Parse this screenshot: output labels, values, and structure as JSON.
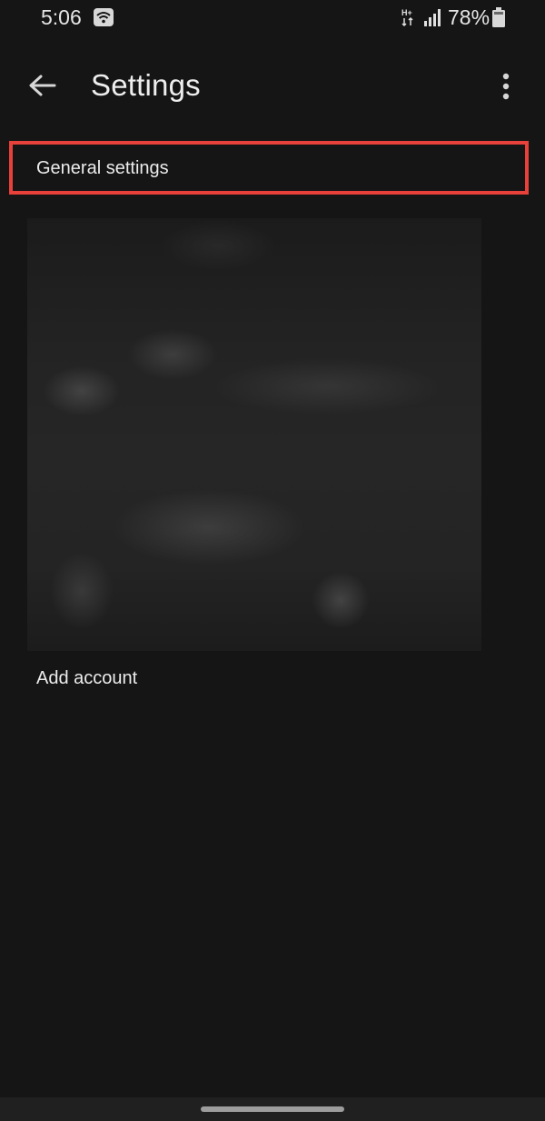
{
  "status_bar": {
    "time": "5:06",
    "network": "H+",
    "battery_percent": "78%",
    "icons": [
      "wifi-icon",
      "data-arrows-icon",
      "signal-icon",
      "battery-icon"
    ]
  },
  "app_bar": {
    "title": "Settings",
    "back_icon": "arrow-back-icon",
    "menu_icon": "more-vert-icon"
  },
  "settings_list": {
    "items": [
      {
        "label": "General settings",
        "highlighted": true
      },
      {
        "label": "Add account"
      }
    ]
  },
  "colors": {
    "background": "#151515",
    "highlight": "#e8403a",
    "text": "#ececec"
  }
}
